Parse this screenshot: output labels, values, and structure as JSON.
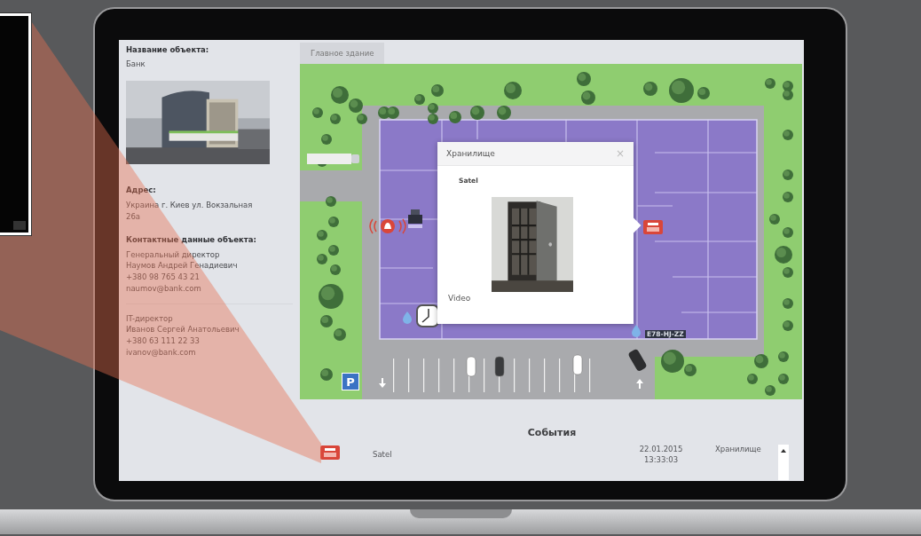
{
  "sidebar": {
    "object_name": {
      "label": "Название объекта:",
      "value": "Банк"
    },
    "address": {
      "label": "Адрес:",
      "value": "Украина г. Киев ул. Вокзальная 26а"
    },
    "contacts": {
      "label": "Контактные данные объекта:",
      "people": [
        {
          "role": "Генеральный директор",
          "name": "Наумов Андрей Генадиевич",
          "phone": "+380 98 765 43 21",
          "email": "naumov@bank.com"
        },
        {
          "role": "IT-директор",
          "name": "Иванов Сергей Анатольевич",
          "phone": "+380 63 111 22 33",
          "email": "ivanov@bank.com"
        }
      ]
    }
  },
  "tabs": [
    {
      "label": "Главное здание",
      "selected": true
    }
  ],
  "map": {
    "parking_sign": "P",
    "plate": "E78-HJ-ZZ",
    "markers": [
      {
        "kind": "alarm"
      },
      {
        "kind": "register"
      },
      {
        "kind": "panel"
      },
      {
        "kind": "clock"
      }
    ],
    "popup": {
      "title": "Хранилище",
      "close": "×",
      "device": "Satel",
      "link": "Video"
    }
  },
  "events": {
    "title": "События",
    "rows": [
      {
        "kind": "panel",
        "source": "Satel",
        "date": "22.01.2015",
        "time": "13:33:03",
        "zone": "Хранилище"
      }
    ]
  }
}
